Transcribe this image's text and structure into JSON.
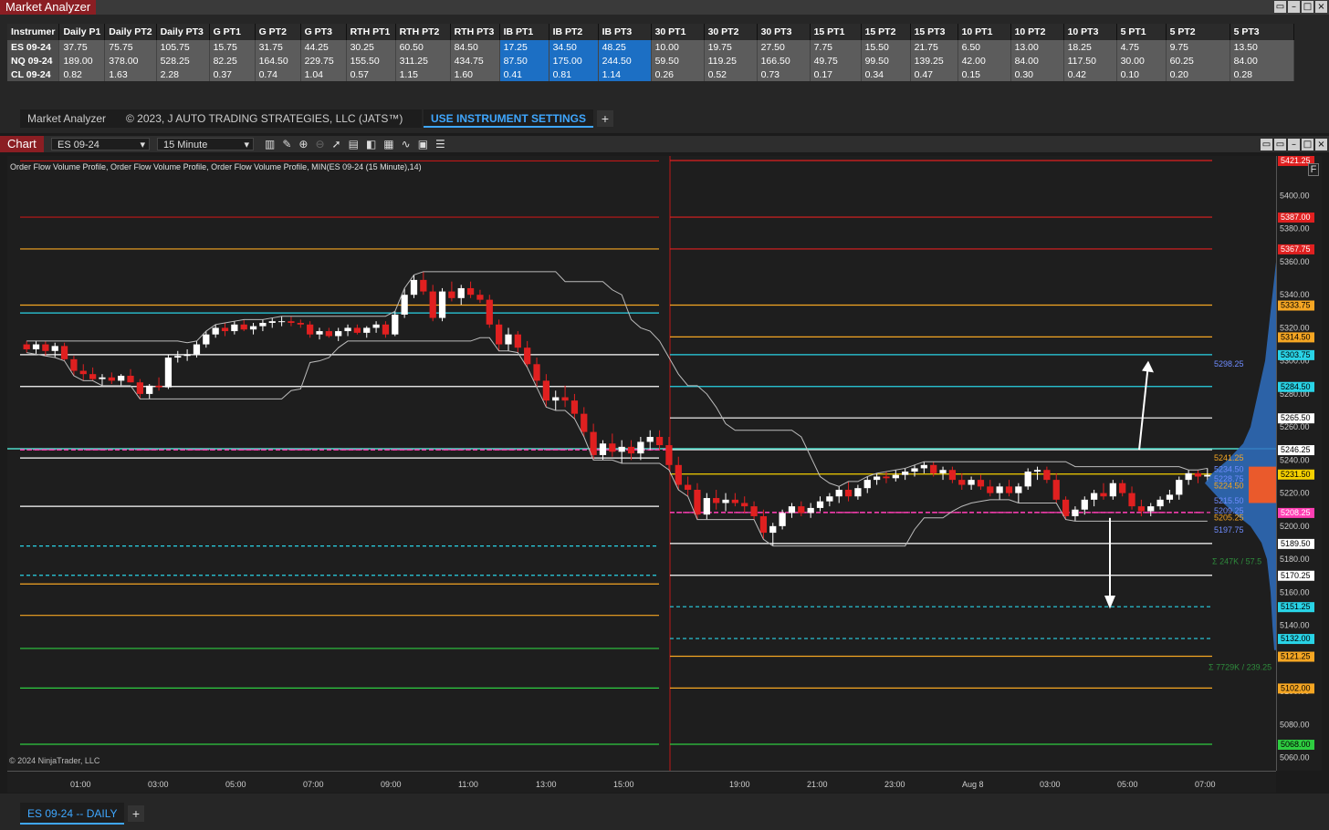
{
  "market_analyzer": {
    "title": "Market Analyzer",
    "columns": [
      "Instrumer",
      "Daily P1",
      "Daily PT2",
      "Daily PT3",
      "G PT1",
      "G PT2",
      "G PT3",
      "RTH PT1",
      "RTH PT2",
      "RTH PT3",
      "IB PT1",
      "IB PT2",
      "IB PT3",
      "30 PT1",
      "30 PT2",
      "30 PT3",
      "15 PT1",
      "15 PT2",
      "15 PT3",
      "10 PT1",
      "10 PT2",
      "10 PT3",
      "5 PT1",
      "5 PT2",
      "5 PT3"
    ],
    "rows": [
      [
        "ES 09-24",
        "37.75",
        "75.75",
        "105.75",
        "15.75",
        "31.75",
        "44.25",
        "30.25",
        "60.50",
        "84.50",
        "17.25",
        "34.50",
        "48.25",
        "10.00",
        "19.75",
        "27.50",
        "7.75",
        "15.50",
        "21.75",
        "6.50",
        "13.00",
        "18.25",
        "4.75",
        "9.75",
        "13.50"
      ],
      [
        "NQ 09-24",
        "189.00",
        "378.00",
        "528.25",
        "82.25",
        "164.50",
        "229.75",
        "155.50",
        "311.25",
        "434.75",
        "87.50",
        "175.00",
        "244.50",
        "59.50",
        "119.25",
        "166.50",
        "49.75",
        "99.50",
        "139.25",
        "42.00",
        "84.00",
        "117.50",
        "30.00",
        "60.25",
        "84.00"
      ],
      [
        "CL 09-24",
        "0.82",
        "1.63",
        "2.28",
        "0.37",
        "0.74",
        "1.04",
        "0.57",
        "1.15",
        "1.60",
        "0.41",
        "0.81",
        "1.14",
        "0.26",
        "0.52",
        "0.73",
        "0.17",
        "0.34",
        "0.47",
        "0.15",
        "0.30",
        "0.42",
        "0.10",
        "0.20",
        "0.28"
      ]
    ],
    "tabs": {
      "tab1": "Market Analyzer",
      "copyright": "© 2023, J AUTO TRADING STRATEGIES, LLC (JATS™)",
      "settings": "USE INSTRUMENT SETTINGS",
      "add": "+"
    }
  },
  "chart_window": {
    "title": "Chart",
    "instrument": "ES 09-24",
    "interval": "15 Minute",
    "indicator_label": "Order Flow Volume Profile, Order Flow Volume Profile, Order Flow Volume Profile, MIN(ES 09-24 (15 Minute),14)",
    "copyright": "© 2024 NinjaTrader, LLC",
    "f_button": "F",
    "bottom_tab": "ES 09-24 -- DAILY",
    "add": "+",
    "poc_label": "5298.25",
    "volume_label_1": "Σ  247K / 57.5",
    "volume_label_2": "Σ  7729K / 239.25"
  },
  "chart_data": {
    "type": "candlestick",
    "time_ticks": [
      "01:00",
      "03:00",
      "05:00",
      "07:00",
      "09:00",
      "11:00",
      "13:00",
      "15:00",
      "19:00",
      "21:00",
      "23:00",
      "Aug 8",
      "03:00",
      "05:00",
      "07:00"
    ],
    "price_ticks": [
      "5400.00",
      "5380.00",
      "5360.00",
      "5340.00",
      "5320.00",
      "5300.00",
      "5280.00",
      "5260.00",
      "5240.00",
      "5220.00",
      "5200.00",
      "5180.00",
      "5160.00",
      "5140.00",
      "5120.00",
      "5100.00",
      "5080.00",
      "5060.00"
    ],
    "price_range": [
      5052,
      5424
    ],
    "level_badges": [
      {
        "v": "5421.25",
        "color": "#e02020"
      },
      {
        "v": "5387.00",
        "color": "#e02020"
      },
      {
        "v": "5367.75",
        "color": "#e02020"
      },
      {
        "v": "5333.75",
        "color": "#f5a623"
      },
      {
        "v": "5314.50",
        "color": "#f5a623"
      },
      {
        "v": "5303.75",
        "color": "#29d3e6"
      },
      {
        "v": "5284.50",
        "color": "#29d3e6"
      },
      {
        "v": "5265.50",
        "color": "#ffffff"
      },
      {
        "v": "5246.25",
        "color": "#ffffff"
      },
      {
        "v": "5231.50",
        "color": "#f5d000"
      },
      {
        "v": "5208.25",
        "color": "#ff3fb4"
      },
      {
        "v": "5189.50",
        "color": "#ffffff"
      },
      {
        "v": "5170.25",
        "color": "#ffffff"
      },
      {
        "v": "5151.25",
        "color": "#29d3e6"
      },
      {
        "v": "5132.00",
        "color": "#29d3e6"
      },
      {
        "v": "5121.25",
        "color": "#f5a623"
      },
      {
        "v": "5102.00",
        "color": "#f5a623"
      },
      {
        "v": "5068.00",
        "color": "#2ecc40"
      }
    ],
    "profile_labels": [
      "5241.25",
      "5234.50",
      "5228.75",
      "5224.50",
      "5215.50",
      "5209.25",
      "5205.25",
      "5197.75"
    ],
    "candles": [
      [
        5310,
        5312,
        5305,
        5307
      ],
      [
        5307,
        5312,
        5304,
        5310
      ],
      [
        5310,
        5312,
        5303,
        5306
      ],
      [
        5306,
        5311,
        5302,
        5309
      ],
      [
        5309,
        5311,
        5300,
        5301
      ],
      [
        5301,
        5303,
        5291,
        5294
      ],
      [
        5294,
        5298,
        5288,
        5292
      ],
      [
        5292,
        5296,
        5288,
        5289
      ],
      [
        5289,
        5292,
        5285,
        5290
      ],
      [
        5290,
        5293,
        5286,
        5288
      ],
      [
        5288,
        5292,
        5285,
        5291
      ],
      [
        5291,
        5295,
        5287,
        5287
      ],
      [
        5287,
        5289,
        5277,
        5280
      ],
      [
        5280,
        5286,
        5277,
        5285
      ],
      [
        5285,
        5290,
        5282,
        5284
      ],
      [
        5284,
        5304,
        5283,
        5302
      ],
      [
        5302,
        5306,
        5299,
        5303
      ],
      [
        5303,
        5307,
        5300,
        5304
      ],
      [
        5304,
        5312,
        5302,
        5310
      ],
      [
        5310,
        5318,
        5308,
        5316
      ],
      [
        5316,
        5322,
        5314,
        5320
      ],
      [
        5320,
        5323,
        5315,
        5318
      ],
      [
        5318,
        5324,
        5316,
        5322
      ],
      [
        5322,
        5325,
        5318,
        5319
      ],
      [
        5319,
        5323,
        5316,
        5321
      ],
      [
        5321,
        5325,
        5318,
        5323
      ],
      [
        5323,
        5326,
        5320,
        5324
      ],
      [
        5324,
        5327,
        5321,
        5324
      ],
      [
        5324,
        5327,
        5321,
        5323
      ],
      [
        5323,
        5325,
        5320,
        5322
      ],
      [
        5322,
        5324,
        5314,
        5316
      ],
      [
        5316,
        5320,
        5313,
        5318
      ],
      [
        5318,
        5320,
        5314,
        5315
      ],
      [
        5315,
        5320,
        5312,
        5318
      ],
      [
        5318,
        5322,
        5315,
        5320
      ],
      [
        5320,
        5322,
        5316,
        5317
      ],
      [
        5317,
        5321,
        5314,
        5320
      ],
      [
        5320,
        5324,
        5317,
        5322
      ],
      [
        5322,
        5324,
        5314,
        5316
      ],
      [
        5316,
        5330,
        5315,
        5328
      ],
      [
        5328,
        5344,
        5326,
        5340
      ],
      [
        5340,
        5352,
        5338,
        5349
      ],
      [
        5349,
        5354,
        5340,
        5342
      ],
      [
        5342,
        5346,
        5324,
        5326
      ],
      [
        5326,
        5344,
        5324,
        5342
      ],
      [
        5342,
        5348,
        5336,
        5338
      ],
      [
        5338,
        5346,
        5334,
        5344
      ],
      [
        5344,
        5348,
        5338,
        5340
      ],
      [
        5340,
        5343,
        5335,
        5337
      ],
      [
        5337,
        5340,
        5320,
        5322
      ],
      [
        5322,
        5325,
        5306,
        5310
      ],
      [
        5310,
        5320,
        5306,
        5316
      ],
      [
        5316,
        5318,
        5305,
        5308
      ],
      [
        5308,
        5312,
        5296,
        5298
      ],
      [
        5298,
        5302,
        5284,
        5288
      ],
      [
        5288,
        5292,
        5272,
        5276
      ],
      [
        5276,
        5282,
        5270,
        5278
      ],
      [
        5278,
        5285,
        5272,
        5276
      ],
      [
        5276,
        5280,
        5265,
        5268
      ],
      [
        5268,
        5272,
        5254,
        5257
      ],
      [
        5257,
        5262,
        5240,
        5243
      ],
      [
        5243,
        5252,
        5240,
        5250
      ],
      [
        5250,
        5256,
        5242,
        5245
      ],
      [
        5245,
        5252,
        5238,
        5248
      ],
      [
        5248,
        5252,
        5240,
        5244
      ],
      [
        5244,
        5254,
        5240,
        5251
      ],
      [
        5251,
        5258,
        5246,
        5254
      ],
      [
        5254,
        5258,
        5246,
        5249
      ],
      [
        5249,
        5254,
        5234,
        5237
      ],
      [
        5237,
        5242,
        5222,
        5225
      ],
      [
        5225,
        5230,
        5218,
        5222
      ],
      [
        5222,
        5226,
        5204,
        5207
      ],
      [
        5207,
        5220,
        5204,
        5217
      ],
      [
        5217,
        5222,
        5210,
        5214
      ],
      [
        5214,
        5220,
        5209,
        5216
      ],
      [
        5216,
        5220,
        5212,
        5214
      ],
      [
        5214,
        5218,
        5208,
        5212
      ],
      [
        5212,
        5215,
        5204,
        5206
      ],
      [
        5206,
        5210,
        5192,
        5196
      ],
      [
        5196,
        5202,
        5188,
        5200
      ],
      [
        5200,
        5210,
        5198,
        5208
      ],
      [
        5208,
        5214,
        5205,
        5212
      ],
      [
        5212,
        5215,
        5206,
        5208
      ],
      [
        5208,
        5214,
        5205,
        5211
      ],
      [
        5211,
        5218,
        5209,
        5215
      ],
      [
        5215,
        5220,
        5212,
        5218
      ],
      [
        5218,
        5224,
        5214,
        5222
      ],
      [
        5222,
        5227,
        5215,
        5218
      ],
      [
        5218,
        5225,
        5216,
        5223
      ],
      [
        5223,
        5230,
        5220,
        5228
      ],
      [
        5228,
        5232,
        5225,
        5230
      ],
      [
        5230,
        5233,
        5226,
        5229
      ],
      [
        5229,
        5234,
        5227,
        5231
      ],
      [
        5231,
        5235,
        5228,
        5233
      ],
      [
        5233,
        5237,
        5230,
        5235
      ],
      [
        5235,
        5239,
        5232,
        5237
      ],
      [
        5237,
        5239,
        5230,
        5232
      ],
      [
        5232,
        5236,
        5228,
        5234
      ],
      [
        5234,
        5236,
        5226,
        5228
      ],
      [
        5228,
        5232,
        5222,
        5225
      ],
      [
        5225,
        5230,
        5222,
        5228
      ],
      [
        5228,
        5231,
        5222,
        5224
      ],
      [
        5224,
        5228,
        5218,
        5220
      ],
      [
        5220,
        5226,
        5216,
        5224
      ],
      [
        5224,
        5228,
        5218,
        5220
      ],
      [
        5220,
        5226,
        5214,
        5224
      ],
      [
        5224,
        5235,
        5222,
        5233
      ],
      [
        5233,
        5236,
        5228,
        5234
      ],
      [
        5234,
        5236,
        5226,
        5228
      ],
      [
        5228,
        5232,
        5214,
        5216
      ],
      [
        5216,
        5218,
        5204,
        5206
      ],
      [
        5206,
        5212,
        5203,
        5210
      ],
      [
        5210,
        5218,
        5207,
        5216
      ],
      [
        5216,
        5222,
        5212,
        5220
      ],
      [
        5220,
        5226,
        5216,
        5218
      ],
      [
        5218,
        5228,
        5216,
        5226
      ],
      [
        5226,
        5228,
        5218,
        5220
      ],
      [
        5220,
        5224,
        5210,
        5212
      ],
      [
        5212,
        5216,
        5206,
        5209
      ],
      [
        5209,
        5214,
        5206,
        5212
      ],
      [
        5212,
        5218,
        5210,
        5216
      ],
      [
        5216,
        5222,
        5214,
        5219
      ],
      [
        5219,
        5230,
        5216,
        5228
      ],
      [
        5228,
        5234,
        5225,
        5232
      ],
      [
        5232,
        5234,
        5226,
        5230
      ],
      [
        5230,
        5235,
        5227,
        5231
      ]
    ]
  }
}
